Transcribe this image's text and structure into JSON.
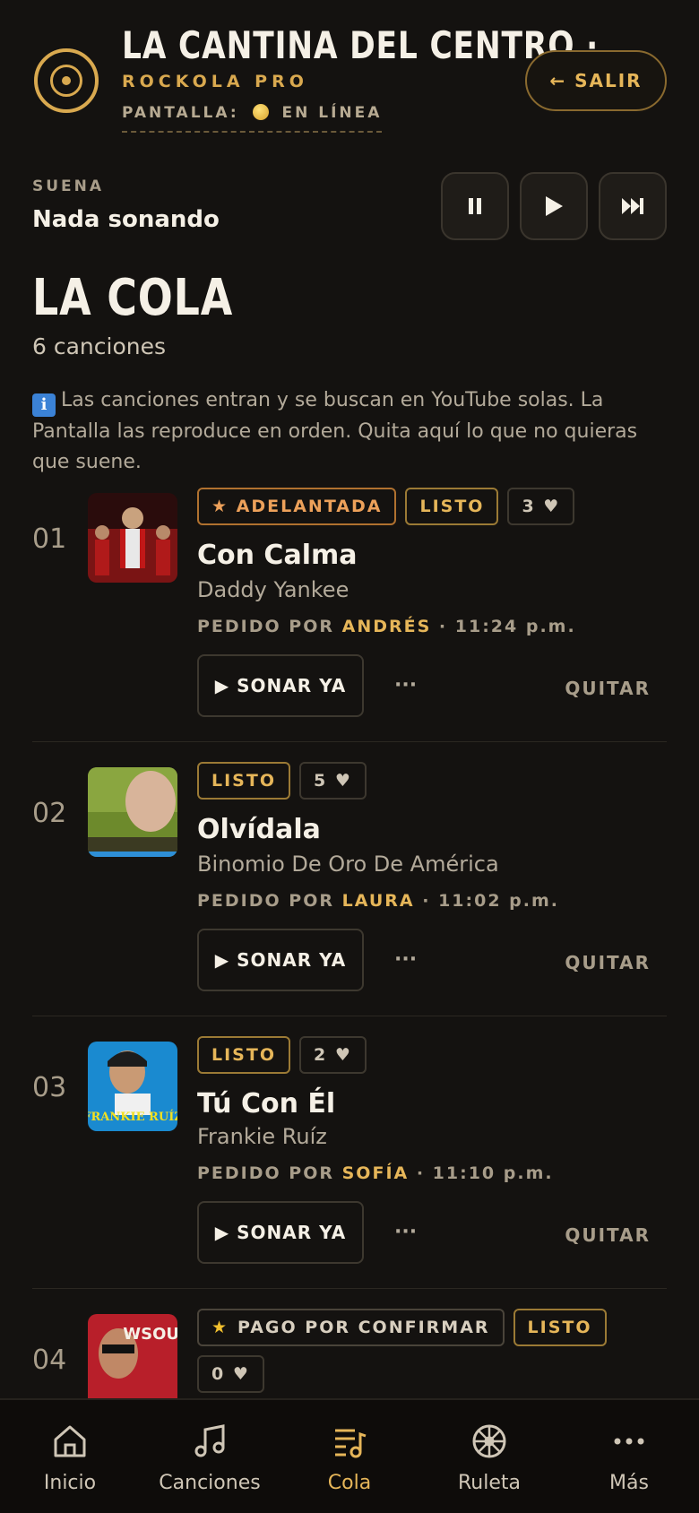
{
  "header": {
    "title": "LA CANTINA DEL CENTRO ·...",
    "subtitle": "ROCKOLA PRO",
    "screen_label": "PANTALLA:",
    "screen_status": "EN LÍNEA",
    "exit_label": "← SALIR"
  },
  "now_playing": {
    "label": "SUENA",
    "title": "Nada sonando",
    "controls": [
      "pause-icon",
      "play-icon",
      "skip-next-icon"
    ]
  },
  "queue": {
    "title": "LA COLA",
    "count": "6 canciones",
    "info": "Las canciones entran y se buscan en YouTube solas. La Pantalla las reproduce en orden. Quita aquí lo que no quieras que suene.",
    "items": [
      {
        "num": "01",
        "badges": [
          "★ ADELANTADA",
          "LISTO",
          "3 ♥"
        ],
        "title": "Con Calma",
        "artist": "Daddy Yankee",
        "requested_prefix": "PEDIDO POR",
        "requested_by": "ANDRÉS",
        "time": "· 11:24 p.m.",
        "play_label": "▶ SONAR YA",
        "more_label": "···",
        "remove_label": "QUITAR"
      },
      {
        "num": "02",
        "badges": [
          "LISTO",
          "5 ♥"
        ],
        "title": "Olvídala",
        "artist": "Binomio De Oro De América",
        "requested_prefix": "PEDIDO POR",
        "requested_by": "LAURA",
        "time": "· 11:02 p.m.",
        "play_label": "▶ SONAR YA",
        "more_label": "···",
        "remove_label": "QUITAR"
      },
      {
        "num": "03",
        "badges": [
          "LISTO",
          "2 ♥"
        ],
        "title": "Tú Con Él",
        "artist": "Frankie Ruíz",
        "requested_prefix": "PEDIDO POR",
        "requested_by": "SOFÍA",
        "time": "· 11:10 p.m.",
        "play_label": "▶ SONAR YA",
        "more_label": "···",
        "remove_label": "QUITAR",
        "thumb_text": "FRANKIE RUÍZ"
      },
      {
        "num": "04",
        "badges": [
          "PAGO POR CONFIRMAR",
          "LISTO",
          "0 ♥"
        ],
        "thumb_text": "WSOUI"
      }
    ]
  },
  "nav": {
    "items": [
      {
        "label": "Inicio",
        "icon": "home-icon"
      },
      {
        "label": "Canciones",
        "icon": "music-note-icon"
      },
      {
        "label": "Cola",
        "icon": "queue-icon"
      },
      {
        "label": "Ruleta",
        "icon": "wheel-icon"
      },
      {
        "label": "Más",
        "icon": "more-icon"
      }
    ],
    "active": "Cola"
  },
  "colors": {
    "accent": "#e6b659",
    "background": "#141210"
  }
}
